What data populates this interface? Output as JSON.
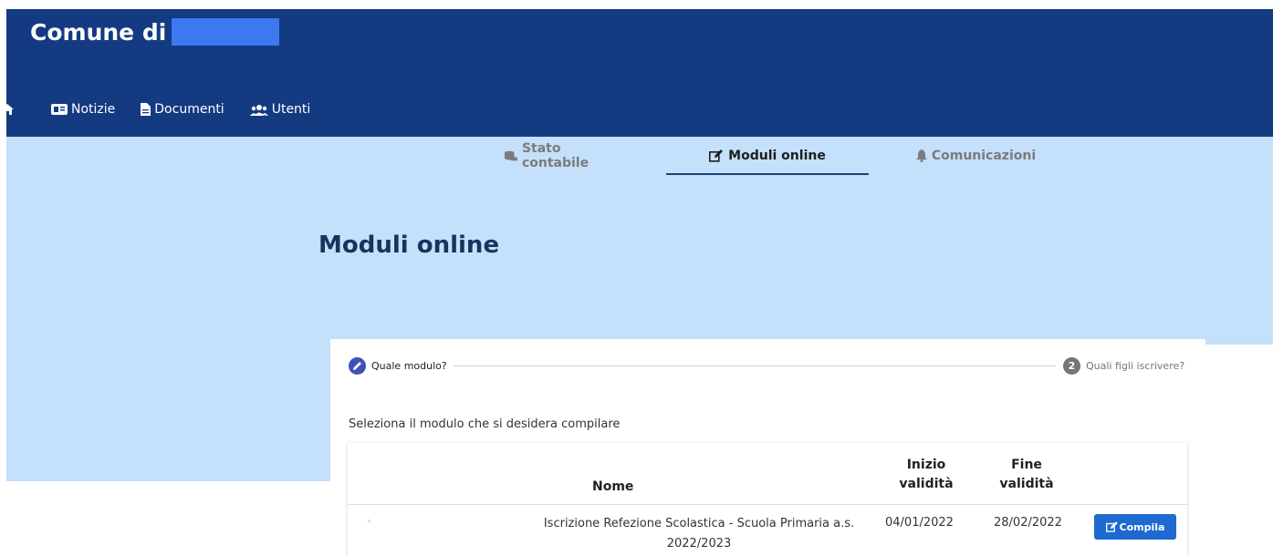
{
  "header": {
    "brand": "Comune di",
    "bg_color": "#143a82"
  },
  "topnav": {
    "home_icon": "home-icon",
    "items": [
      {
        "label": "Notizie",
        "icon": "newspaper-icon"
      },
      {
        "label": "Documenti",
        "icon": "document-icon"
      },
      {
        "label": "Utenti",
        "icon": "users-icon"
      }
    ]
  },
  "tabs": [
    {
      "label": "Stato contabile",
      "icon": "coins-icon",
      "active": false
    },
    {
      "label": "Moduli online",
      "icon": "edit-icon",
      "active": true
    },
    {
      "label": "Comunicazioni",
      "icon": "bell-icon",
      "active": false
    }
  ],
  "page": {
    "title": "Moduli online",
    "band_color": "#c4e0fb"
  },
  "stepper": {
    "step1_label": "Quale modulo?",
    "step2_number": "2",
    "step2_label": "Quali figli iscrivere?"
  },
  "instruction": "Seleziona il modulo che si desidera compilare",
  "table": {
    "headers": {
      "nome": "Nome",
      "inizio_line1": "Inizio",
      "inizio_line2": "validità",
      "fine_line1": "Fine",
      "fine_line2": "validità"
    },
    "rows": [
      {
        "nome": "Iscrizione Refezione Scolastica - Scuola Primaria a.s. 2022/2023",
        "inizio": "04/01/2022",
        "fine": "28/02/2022",
        "action": "Compila"
      }
    ]
  }
}
